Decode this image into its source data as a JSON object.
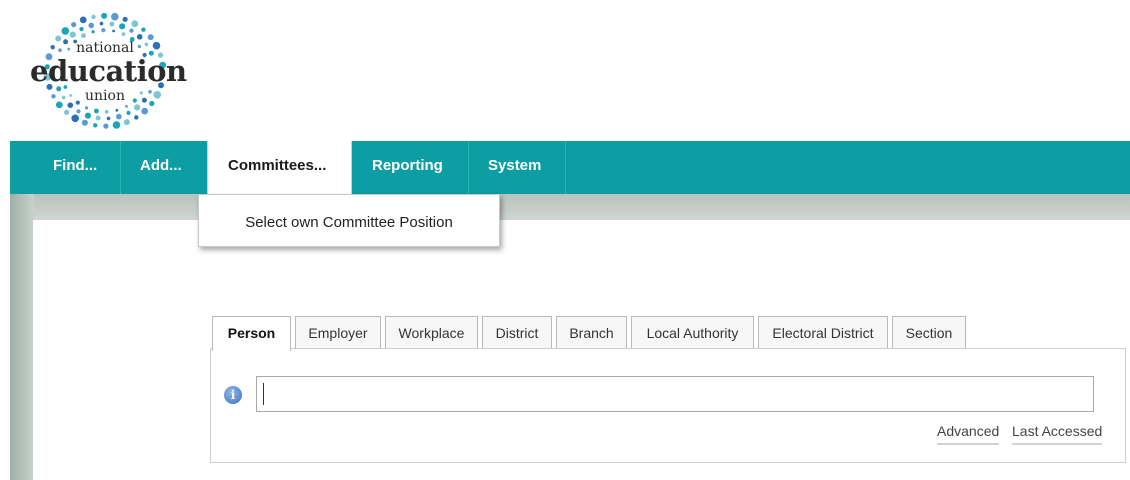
{
  "logo": {
    "line1": "national",
    "line2": "education",
    "line3": "union",
    "dot_colors": [
      "#1aa6b7",
      "#5b9bd5",
      "#2e6fb6",
      "#7cc6d6"
    ]
  },
  "nav": {
    "items": [
      {
        "label": "Find..."
      },
      {
        "label": "Add..."
      },
      {
        "label": "Committees..."
      },
      {
        "label": "Reporting"
      },
      {
        "label": "System"
      }
    ],
    "active_index": 2,
    "bar_color": "#0c9ea3"
  },
  "dropdown": {
    "items": [
      {
        "label": "Select own Committee Position"
      }
    ]
  },
  "tabs": [
    {
      "label": "Person"
    },
    {
      "label": "Employer"
    },
    {
      "label": "Workplace"
    },
    {
      "label": "District"
    },
    {
      "label": "Branch"
    },
    {
      "label": "Local Authority"
    },
    {
      "label": "Electoral District"
    },
    {
      "label": "Section"
    }
  ],
  "active_tab": 0,
  "search": {
    "value": "",
    "placeholder": "",
    "info_icon": "info-icon"
  },
  "actions": {
    "advanced_label": "Advanced",
    "last_accessed_label": "Last Accessed"
  }
}
